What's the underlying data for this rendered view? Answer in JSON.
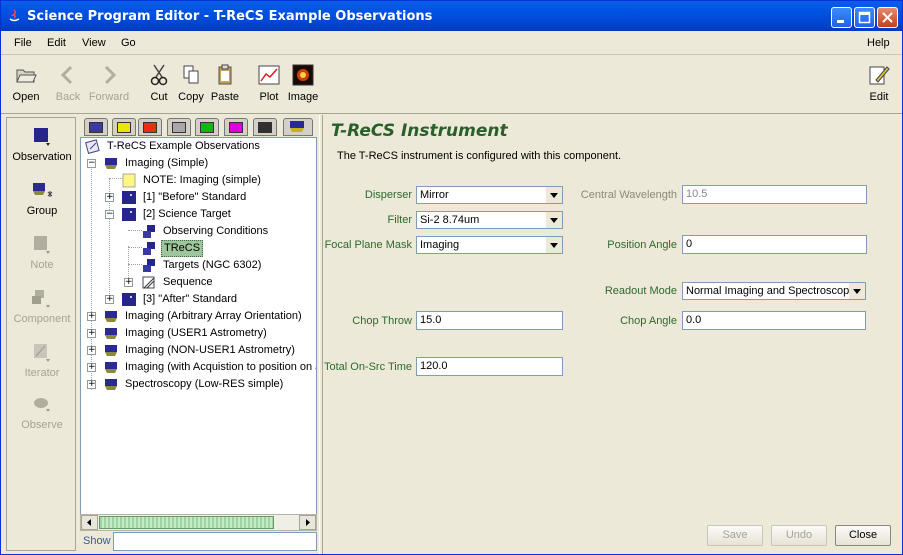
{
  "window": {
    "title": "Science Program Editor - T-ReCS Example Observations"
  },
  "menu": {
    "file": "File",
    "edit": "Edit",
    "view": "View",
    "go": "Go",
    "help": "Help"
  },
  "toolbar": {
    "open": "Open",
    "back": "Back",
    "forward": "Forward",
    "cut": "Cut",
    "copy": "Copy",
    "paste": "Paste",
    "plot": "Plot",
    "image": "Image",
    "edit": "Edit"
  },
  "palette": {
    "observation": "Observation",
    "group": "Group",
    "note": "Note",
    "component": "Component",
    "iterator": "Iterator",
    "observe": "Observe"
  },
  "swatches": [
    "#3a3aa0",
    "#e8e800",
    "#e83010",
    "#a8a8a8",
    "#10b810",
    "#e000e0",
    "#303030"
  ],
  "tree": {
    "root": "T-ReCS Example Observations",
    "imaging_simple": "Imaging (Simple)",
    "note": "NOTE: Imaging (simple)",
    "before_standard": "[1] \"Before\" Standard",
    "science_target": "[2] Science Target",
    "observing_conditions": "Observing Conditions",
    "trecs": "TReCS",
    "targets": "Targets (NGC 6302)",
    "sequence": "Sequence",
    "after_standard": "[3] \"After\" Standard",
    "imaging_arbitrary": "Imaging (Arbitrary Array Orientation)",
    "imaging_user1": "Imaging (USER1 Astrometry)",
    "imaging_nonuser1": "Imaging (NON-USER1 Astrometry)",
    "imaging_acquisition": "Imaging (with Acquistion to position on a",
    "spectroscopy": "Spectroscopy (Low-RES simple)"
  },
  "show_label": "Show",
  "show_value": "",
  "editor": {
    "title": "T-ReCS Instrument",
    "description": "The T-ReCS instrument is configured with this component.",
    "disperser_label": "Disperser",
    "disperser_value": "Mirror",
    "filter_label": "Filter",
    "filter_value": "Si-2 8.74um",
    "fpm_label": "Focal Plane Mask",
    "fpm_value": "Imaging",
    "central_wavelength_label": "Central Wavelength",
    "central_wavelength_value": "10.5",
    "position_angle_label": "Position Angle",
    "position_angle_value": "0",
    "readout_mode_label": "Readout Mode",
    "readout_mode_value": "Normal Imaging and Spectroscopy",
    "chop_throw_label": "Chop Throw",
    "chop_throw_value": "15.0",
    "chop_angle_label": "Chop Angle",
    "chop_angle_value": "0.0",
    "total_time_label": "Total On-Src Time",
    "total_time_value": "120.0",
    "save": "Save",
    "undo": "Undo",
    "close": "Close"
  }
}
